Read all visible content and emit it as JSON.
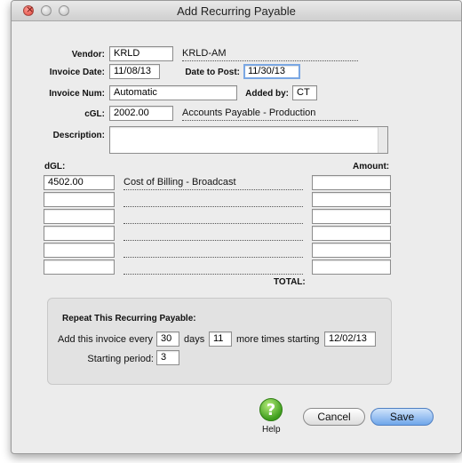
{
  "window": {
    "title": "Add Recurring Payable"
  },
  "form": {
    "vendor_label": "Vendor:",
    "vendor_value": "KRLD",
    "vendor_name": "KRLD-AM",
    "invoice_date_label": "Invoice Date:",
    "invoice_date_value": "11/08/13",
    "date_to_post_label": "Date to Post:",
    "date_to_post_value": "11/30/13",
    "invoice_num_label": "Invoice Num:",
    "invoice_num_value": "Automatic",
    "added_by_label": "Added by:",
    "added_by_value": "CT",
    "cgl_label": "cGL:",
    "cgl_value": "2002.00",
    "cgl_name": "Accounts Payable - Production",
    "description_label": "Description:",
    "description_value": ""
  },
  "distribution": {
    "dgl_label": "dGL:",
    "amount_label": "Amount:",
    "total_label": "TOTAL:",
    "rows": [
      {
        "gl": "4502.00",
        "desc": "Cost of Billing - Broadcast",
        "amount": ""
      },
      {
        "gl": "",
        "desc": "",
        "amount": ""
      },
      {
        "gl": "",
        "desc": "",
        "amount": ""
      },
      {
        "gl": "",
        "desc": "",
        "amount": ""
      },
      {
        "gl": "",
        "desc": "",
        "amount": ""
      },
      {
        "gl": "",
        "desc": "",
        "amount": ""
      }
    ]
  },
  "recurring": {
    "heading": "Repeat This Recurring Payable:",
    "add_every_label": "Add this invoice every",
    "every_value": "30",
    "days_label": "days",
    "times_value": "11",
    "more_times_label": "more times starting",
    "start_date_value": "12/02/13",
    "starting_period_label": "Starting period:",
    "starting_period_value": "3"
  },
  "buttons": {
    "help": "Help",
    "help_icon_glyph": "?",
    "cancel": "Cancel",
    "save": "Save"
  },
  "colors": {
    "save_button": "#6fa6ea",
    "help_icon": "#3f9e1e",
    "focus_ring": "#7aa7e3"
  }
}
